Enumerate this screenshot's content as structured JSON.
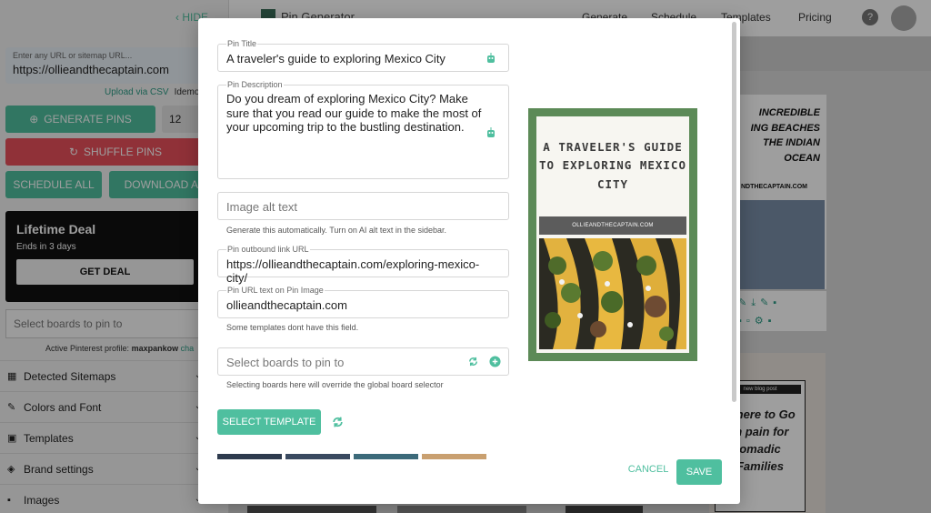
{
  "sidebar": {
    "hide_label": "HIDE",
    "url_placeholder": "Enter any URL or sitemap URL...",
    "url_value": "https://ollieandthecaptain.com",
    "upload_csv": "Upload via CSV",
    "idemo": "Idemo f",
    "generate_label": "GENERATE PINS",
    "pin_count": "12",
    "shuffle_label": "SHUFFLE PINS",
    "schedule_all": "SCHEDULE ALL",
    "download_all": "DOWNLOAD ALL",
    "deal": {
      "title": "Lifetime Deal",
      "ends": "Ends in 3 days",
      "button": "GET DEAL"
    },
    "boards_placeholder": "Select boards to pin to",
    "profile_prefix": "Active Pinterest profile:",
    "profile_name": "maxpankow",
    "profile_change": "cha",
    "accordion": [
      "Detected Sitemaps",
      "Colors and Font",
      "Templates",
      "Brand settings",
      "Images"
    ]
  },
  "topnav": {
    "brand": "Pin Generator",
    "links": [
      "Generate",
      "Schedule",
      "Templates",
      "Pricing"
    ],
    "help": "?"
  },
  "background_pins": {
    "beach_title": "INCREDIBLE\nING BEACHES\nTHE INDIAN\nOCEAN",
    "beach_url": "NDTHECAPTAIN.COM",
    "nomad_header": "new blog post",
    "nomad_title": "Where to Go in pain for omadic Families"
  },
  "modal": {
    "pin_title": {
      "label": "Pin Title",
      "value": "A traveler's guide to exploring Mexico City"
    },
    "pin_description": {
      "label": "Pin Description",
      "value": "Do you dream of exploring Mexico City? Make sure that you read our guide to make the most of your upcoming trip to the bustling destination."
    },
    "alt_text": {
      "placeholder": "Image alt text",
      "hint": "Generate this automatically. Turn on AI alt text in the sidebar."
    },
    "outbound_url": {
      "label": "Pin outbound link URL",
      "value": "https://ollieandthecaptain.com/exploring-mexico-city/"
    },
    "url_text": {
      "label": "Pin URL text on Pin Image",
      "value": "ollieandthecaptain.com",
      "hint": "Some templates dont have this field."
    },
    "boards": {
      "placeholder": "Select boards to pin to",
      "hint": "Selecting boards here will override the global board selector"
    },
    "select_template": "SELECT TEMPLATE",
    "cancel": "CANCEL",
    "save": "SAVE"
  },
  "pin_preview": {
    "title": "A TRAVELER'S GUIDE TO EXPLORING MEXICO CITY",
    "url_text": "OLLIEANDTHECAPTAIN.COM"
  },
  "colors": {
    "accent": "#4fbf9f",
    "danger": "#e8505b",
    "pin_border": "#5c8a57"
  }
}
